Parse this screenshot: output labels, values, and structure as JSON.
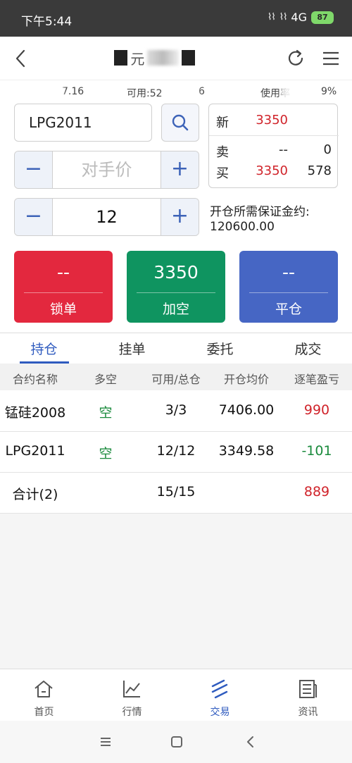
{
  "status": {
    "time": "下午5:44",
    "network": "4G",
    "battery": "87"
  },
  "header": {
    "title": "元"
  },
  "account": {
    "equity_fragment": "7.16",
    "available_label": "可用:",
    "available_fragment": "52",
    "avail_tail": "6",
    "usage_label": "使用率",
    "usage_fragment": "9%"
  },
  "order": {
    "contract": "LPG2011",
    "price_placeholder": "对手价",
    "quantity": "12",
    "minus": "−",
    "plus": "+"
  },
  "quote": {
    "last_label": "新",
    "last_price": "3350",
    "ask_label": "卖",
    "ask_price": "--",
    "ask_volume": "0",
    "bid_label": "买",
    "bid_price": "3350",
    "bid_volume": "578"
  },
  "margin": {
    "label": "开仓所需保证金约:",
    "value": "120600.00"
  },
  "actions": {
    "lock_price": "--",
    "lock_label": "锁单",
    "add_price": "3350",
    "add_label": "加空",
    "close_price": "--",
    "close_label": "平仓"
  },
  "tabs": [
    "持仓",
    "挂单",
    "委托",
    "成交"
  ],
  "table": {
    "headers": [
      "合约名称",
      "多空",
      "可用/总仓",
      "开仓均价",
      "逐笔盈亏"
    ],
    "rows": [
      {
        "contract": "锰硅2008",
        "direction": "空",
        "qty": "3/3",
        "avg_price": "7406.00",
        "pnl": "990"
      },
      {
        "contract": "LPG2011",
        "direction": "空",
        "qty": "12/12",
        "avg_price": "3349.58",
        "pnl": "-101"
      }
    ],
    "total": {
      "label": "合计(2)",
      "qty": "15/15",
      "pnl": "889"
    }
  },
  "nav": [
    "首页",
    "行情",
    "交易",
    "资讯"
  ],
  "colors": {
    "accent": "#2f5bbf",
    "profit": "#d0232a",
    "loss": "#1a8a3c",
    "lock": "#e3283e",
    "add": "#0f9460",
    "close": "#4666c4"
  }
}
